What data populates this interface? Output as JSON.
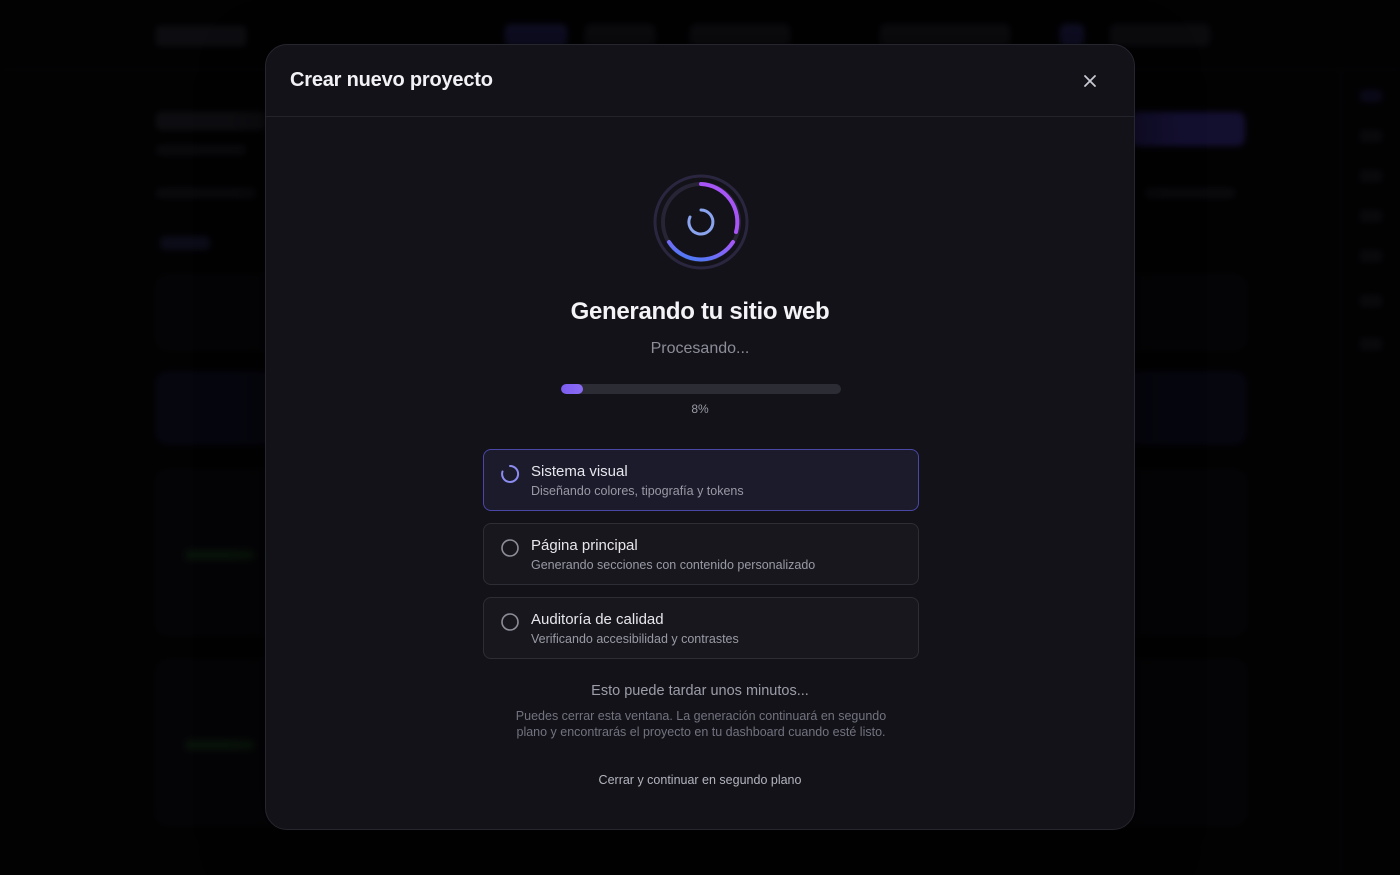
{
  "modal": {
    "title": "Crear nuevo proyecto",
    "close_icon": "close-icon"
  },
  "generation": {
    "heading": "Generando tu sitio web",
    "status": "Procesando...",
    "progress_percent": 8,
    "progress_label": "8%"
  },
  "steps": [
    {
      "title": "Sistema visual",
      "description": "Diseñando colores, tipografía y tokens",
      "state": "in-progress",
      "icon": "spinner-icon"
    },
    {
      "title": "Página principal",
      "description": "Generando secciones con contenido personalizado",
      "state": "pending",
      "icon": "circle-icon"
    },
    {
      "title": "Auditoría de calidad",
      "description": "Verificando accesibilidad y contrastes",
      "state": "pending",
      "icon": "circle-icon"
    }
  ],
  "footer": {
    "wait_note": "Esto puede tardar unos minutos...",
    "info": "Puedes cerrar esta ventana. La generación continuará en segundo plano y encontrarás el proyecto en tu dashboard cuando esté listo.",
    "background_link": "Cerrar y continuar en segundo plano"
  },
  "colors": {
    "accent": "#7b5cf0",
    "spinner_gradient_start": "#3b82f6",
    "spinner_gradient_end": "#a855f7",
    "active_step_border": "#4a47a6"
  }
}
